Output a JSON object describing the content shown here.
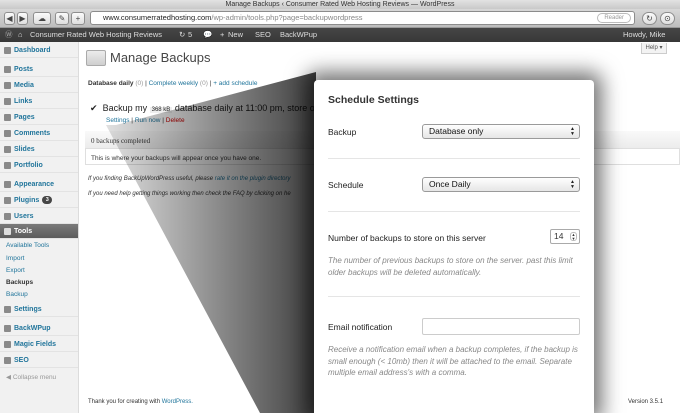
{
  "window": {
    "title": "Manage Backups ‹ Consumer Rated Web Hosting Reviews — WordPress"
  },
  "browser": {
    "url_host": "www.consumerratedhosting.com",
    "url_path": "/wp-admin/tools.php?page=backupwordpress",
    "reader_label": "Reader"
  },
  "adminbar": {
    "site_name": "Consumer Rated Web Hosting Reviews",
    "updates_count": "5",
    "new_label": "New",
    "seo_label": "SEO",
    "backwpup_label": "BackWPup",
    "howdy": "Howdy, Mike"
  },
  "sidebar": {
    "items": [
      {
        "label": "Dashboard"
      },
      {
        "label": "Posts"
      },
      {
        "label": "Media"
      },
      {
        "label": "Links"
      },
      {
        "label": "Pages"
      },
      {
        "label": "Comments"
      },
      {
        "label": "Slides"
      },
      {
        "label": "Portfolio"
      },
      {
        "label": "Appearance"
      },
      {
        "label": "Plugins",
        "badge": "3"
      },
      {
        "label": "Users"
      },
      {
        "label": "Tools"
      },
      {
        "label": "Settings"
      },
      {
        "label": "BackWPup"
      },
      {
        "label": "Magic Fields"
      },
      {
        "label": "SEO"
      }
    ],
    "submenu": [
      "Available Tools",
      "Import",
      "Export",
      "Backups",
      "Backup"
    ],
    "collapse_label": "Collapse menu"
  },
  "main": {
    "help_label": "Help",
    "page_title": "Manage Backups",
    "schedules": {
      "daily": "Database daily",
      "daily_count": "(0)",
      "weekly": "Complete weekly",
      "weekly_count": "(0)",
      "add": "+ add schedule"
    },
    "schedule_line": {
      "pre": "Backup my",
      "size": "368 kB",
      "post": "database daily at 11:00 pm, store o"
    },
    "actions": {
      "settings": "Settings",
      "run_now": "Run now",
      "delete": "Delete"
    },
    "table_header": "0 backups completed",
    "table_empty": "This is where your backups will appear once you have one.",
    "note1_pre": "If you finding BackUpWordPress useful, please",
    "note1_link": "rate it on the plugin directory",
    "note2": "If you need help getting things working then check the FAQ by clicking on he",
    "footer_pre": "Thank you for creating with",
    "footer_link": "WordPress.",
    "version": "Version 3.5.1"
  },
  "modal": {
    "title": "Schedule Settings",
    "backup_label": "Backup",
    "backup_value": "Database only",
    "schedule_label": "Schedule",
    "schedule_value": "Once Daily",
    "store_label": "Number of backups to store on this server",
    "store_value": "14",
    "store_desc": "The number of previous backups to store on the server. past this limit older backups will be deleted automatically.",
    "email_label": "Email notification",
    "email_value": "",
    "email_desc": "Receive a notification email when a backup completes, if the backup is small enough (< 10mb) then it will be attached to the email. Separate multiple email address's with a comma."
  }
}
